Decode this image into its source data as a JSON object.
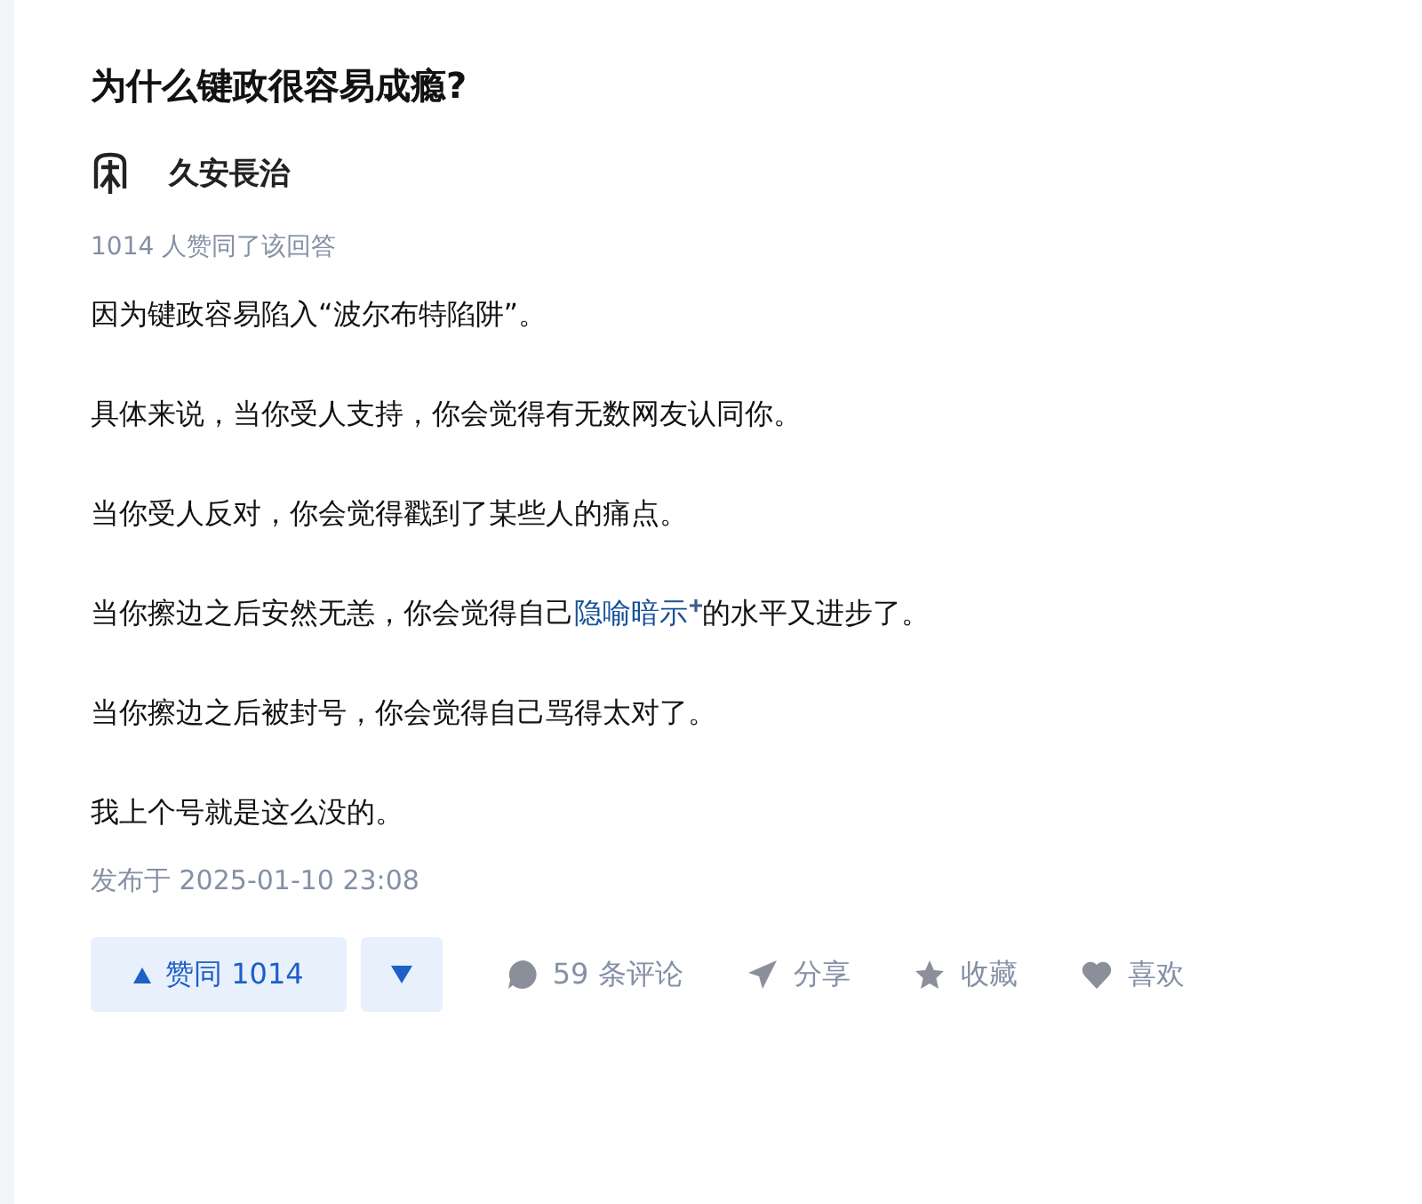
{
  "question": {
    "title": "为什么键政很容易成瘾?"
  },
  "author": {
    "name": "久安長治"
  },
  "votes_summary": "1014 人赞同了该回答",
  "paragraphs": [
    {
      "text": "因为键政容易陷入“波尔布特陷阱”。"
    },
    {
      "text": "具体来说，当你受人支持，你会觉得有无数网友认同你。"
    },
    {
      "text": "当你受人反对，你会觉得戳到了某些人的痛点。"
    },
    {
      "text": "当你擦边之后安然无恙，你会觉得自己",
      "link": "隐喻暗示",
      "after": "的水平又进步了。"
    },
    {
      "text": "当你擦边之后被封号，你会觉得自己骂得太对了。"
    },
    {
      "text": "我上个号就是这么没的。"
    }
  ],
  "published": "发布于 2025-01-10 23:08",
  "actions": {
    "upvote": "赞同 1014",
    "comments": "59 条评论",
    "share": "分享",
    "favorite": "收藏",
    "like": "喜欢"
  }
}
